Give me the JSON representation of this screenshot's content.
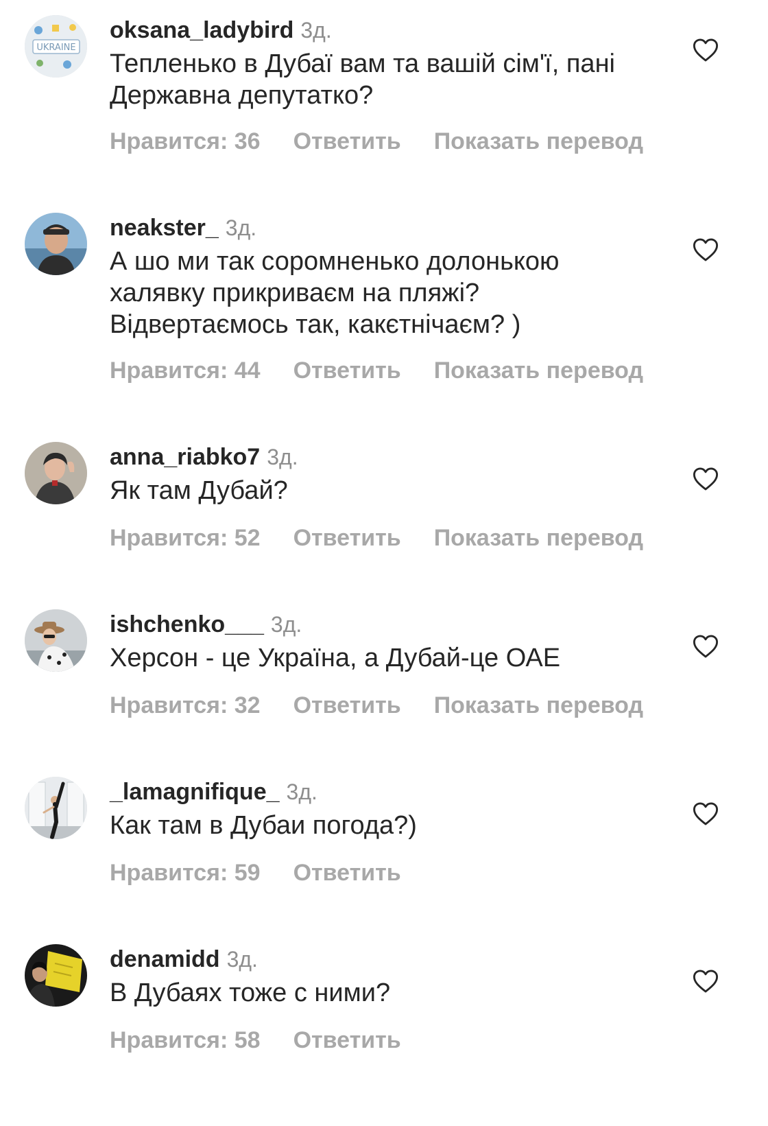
{
  "comments": [
    {
      "username": "oksana_ladybird",
      "time": "3д.",
      "text": "Тепленько в Дубаї вам та вашій сім'ї, пані Державна депутатко?",
      "likes_label": "Нравится: 36",
      "reply_label": "Ответить",
      "translate_label": "Показать перевод",
      "avatar_icon": "ukraine-doodle-avatar"
    },
    {
      "username": "neakster_",
      "time": "3д.",
      "text": "А шо ми так соромненько долонькою халявку прикриваєм на пляжі? Відвертаємось так, какєтнічаєм? )",
      "likes_label": "Нравится: 44",
      "reply_label": "Ответить",
      "translate_label": "Показать перевод",
      "avatar_icon": "man-cap-avatar"
    },
    {
      "username": "anna_riabko7",
      "time": "3д.",
      "text": "Як там Дубай?",
      "likes_label": "Нравится: 52",
      "reply_label": "Ответить",
      "translate_label": "Показать перевод",
      "avatar_icon": "woman-portrait-avatar"
    },
    {
      "username": "ishchenko___",
      "time": "3д.",
      "text": "Херсон - це Україна, а Дубай-це ОАЕ",
      "likes_label": "Нравится: 32",
      "reply_label": "Ответить",
      "translate_label": "Показать перевод",
      "avatar_icon": "woman-hat-avatar"
    },
    {
      "username": "_lamagnifique_",
      "time": "3д.",
      "text": "Как там в Дубаи погода?)",
      "likes_label": "Нравится: 59",
      "reply_label": "Ответить",
      "avatar_icon": "dancer-avatar"
    },
    {
      "username": "denamidd",
      "time": "3д.",
      "text": "В Дубаях тоже с ними?",
      "likes_label": "Нравится: 58",
      "reply_label": "Ответить",
      "avatar_icon": "flag-person-avatar"
    }
  ],
  "colors": {
    "primary_text": "#262626",
    "secondary_text": "#8e8e8e",
    "action_text": "#a8a8a8"
  }
}
